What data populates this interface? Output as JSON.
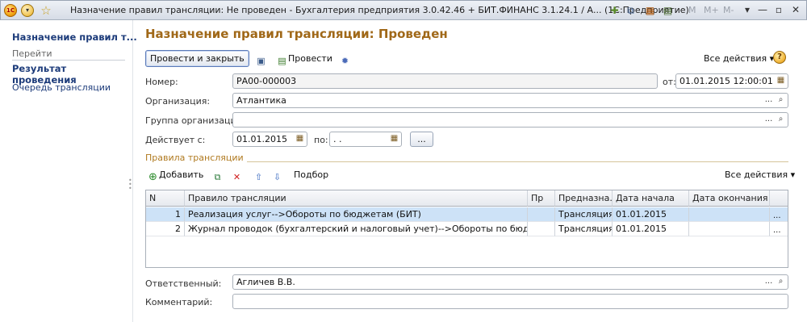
{
  "window": {
    "title": "Назначение правил трансляции: Не проведен - Бухгалтерия предприятия 3.0.42.46 + БИТ.ФИНАНС 3.1.24.1 / А...  (1С:Предприятие)",
    "logo_text": "1С",
    "mem_buttons": [
      "M",
      "M+",
      "M-"
    ],
    "controls": [
      "▾",
      "—",
      "▫",
      "✕"
    ]
  },
  "sidebar": {
    "title": "Назначение правил т...",
    "goto_label": "Перейти",
    "items": [
      {
        "label": "Результат проведения"
      },
      {
        "label": "Очередь трансляции"
      }
    ]
  },
  "form": {
    "title": "Назначение правил трансляции: Проведен",
    "toolbar": {
      "post_close": "Провести и закрыть",
      "post": "Провести",
      "all_actions": "Все действия ▾"
    },
    "number_label": "Номер:",
    "number_value": "РА00-000003",
    "date_label": "от:",
    "date_value": "01.01.2015 12:00:01",
    "org_label": "Организация:",
    "org_value": "Атлантика",
    "group_label": "Группа организаций:",
    "group_value": "",
    "valid_from_label": "Действует с:",
    "valid_from_value": "01.01.2015",
    "valid_to_label": "по:",
    "valid_to_value": " .  .",
    "ellipsis": "...",
    "responsible_label": "Ответственный:",
    "responsible_value": "Агличев В.В.",
    "comment_label": "Комментарий:",
    "comment_value": ""
  },
  "rules": {
    "section_title": "Правила трансляции",
    "toolbar": {
      "add": "Добавить",
      "select": "Подбор",
      "all_actions": "Все действия ▾"
    },
    "columns": [
      "N",
      "Правило трансляции",
      "Пр",
      "Предназна...",
      "Дата начала",
      "Дата окончания",
      ""
    ],
    "rows": [
      {
        "n": "1",
        "rule": "Реализация услуг-->Обороты по бюджетам (БИТ)",
        "pr": "",
        "purpose": "Трансляция",
        "start": "01.01.2015",
        "end": "",
        "btn": "..."
      },
      {
        "n": "2",
        "rule": "Журнал проводок (бухгалтерский и налоговый учет)-->Обороты по бюджетам (БИТ)",
        "pr": "",
        "purpose": "Трансляция",
        "start": "01.01.2015",
        "end": "",
        "btn": "..."
      }
    ]
  },
  "colors": {
    "title_orange": "#a06818",
    "link_blue": "#1c3b7a",
    "selected_row": "#cde2f7"
  }
}
